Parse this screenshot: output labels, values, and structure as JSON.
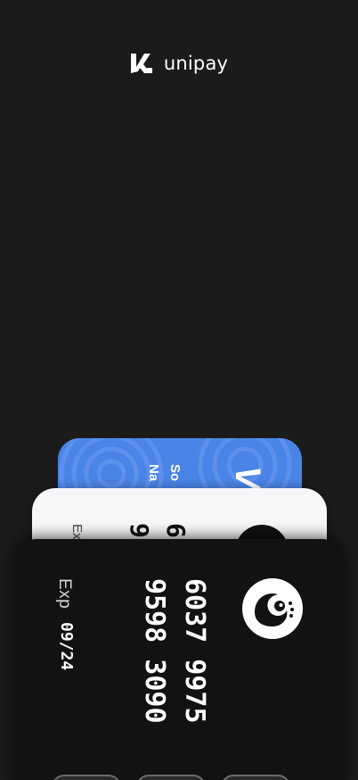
{
  "brand": {
    "name": "unipay",
    "logo_icon": "unipay-logo-icon"
  },
  "cards": {
    "blue": {
      "brand_text": "V",
      "holder_line_1": "So",
      "holder_line_2": "Na",
      "color": "#4a84e6"
    },
    "white": {
      "number_line_1": "6",
      "number_line_2": "9",
      "exp_label": "Ex",
      "color": "#f7f6f8"
    },
    "black": {
      "number_line_1": "6037 9975",
      "number_line_2": "9598 3090",
      "exp_label": "Exp",
      "exp_value": "09/24",
      "logo_icon": "peacock-logo-icon",
      "color": "#121212"
    }
  },
  "colors": {
    "background": "#1b1b1c",
    "accent": "#4a84e6"
  }
}
